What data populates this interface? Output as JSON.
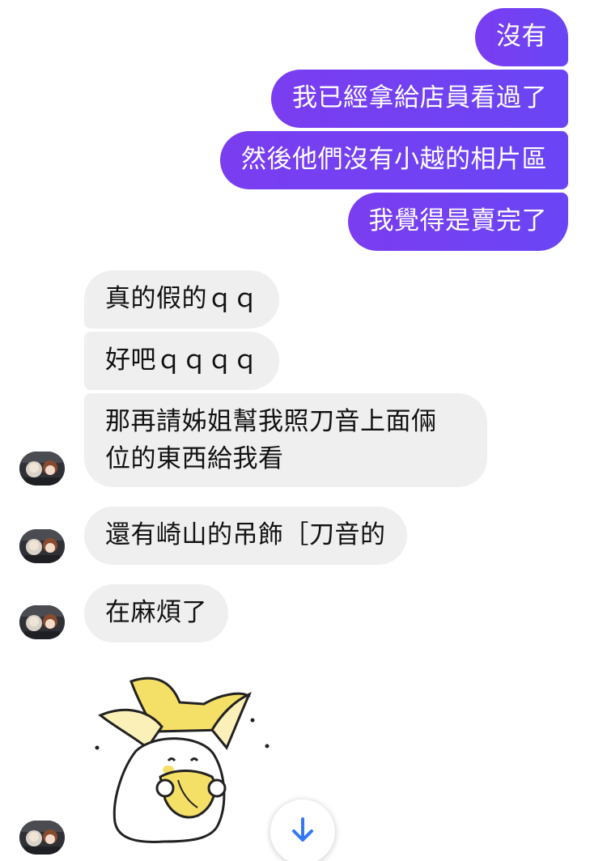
{
  "conversation": {
    "outgoing": [
      {
        "text": "沒有"
      },
      {
        "text": "我已經拿給店員看過了"
      },
      {
        "text": "然後他們沒有小越的相片區"
      },
      {
        "text": "我覺得是賣完了"
      }
    ],
    "incoming": [
      {
        "text": "真的假的ｑｑ"
      },
      {
        "text": "好吧ｑｑｑｑ"
      },
      {
        "line1": "那再請姊姐幫我照刀音上面倆",
        "line2": "位的東西給我看"
      },
      {
        "text": "還有崎山的吊飾［刀音的"
      },
      {
        "text": "在麻煩了"
      }
    ]
  },
  "sticker": {
    "icon": "banana-bear-sticker"
  },
  "scroll_button": {
    "icon": "arrow-down-icon",
    "color": "#3478f6"
  },
  "colors": {
    "outgoing_bubble": "#7040f2",
    "incoming_bubble": "#efefef",
    "incoming_text": "#111111"
  }
}
